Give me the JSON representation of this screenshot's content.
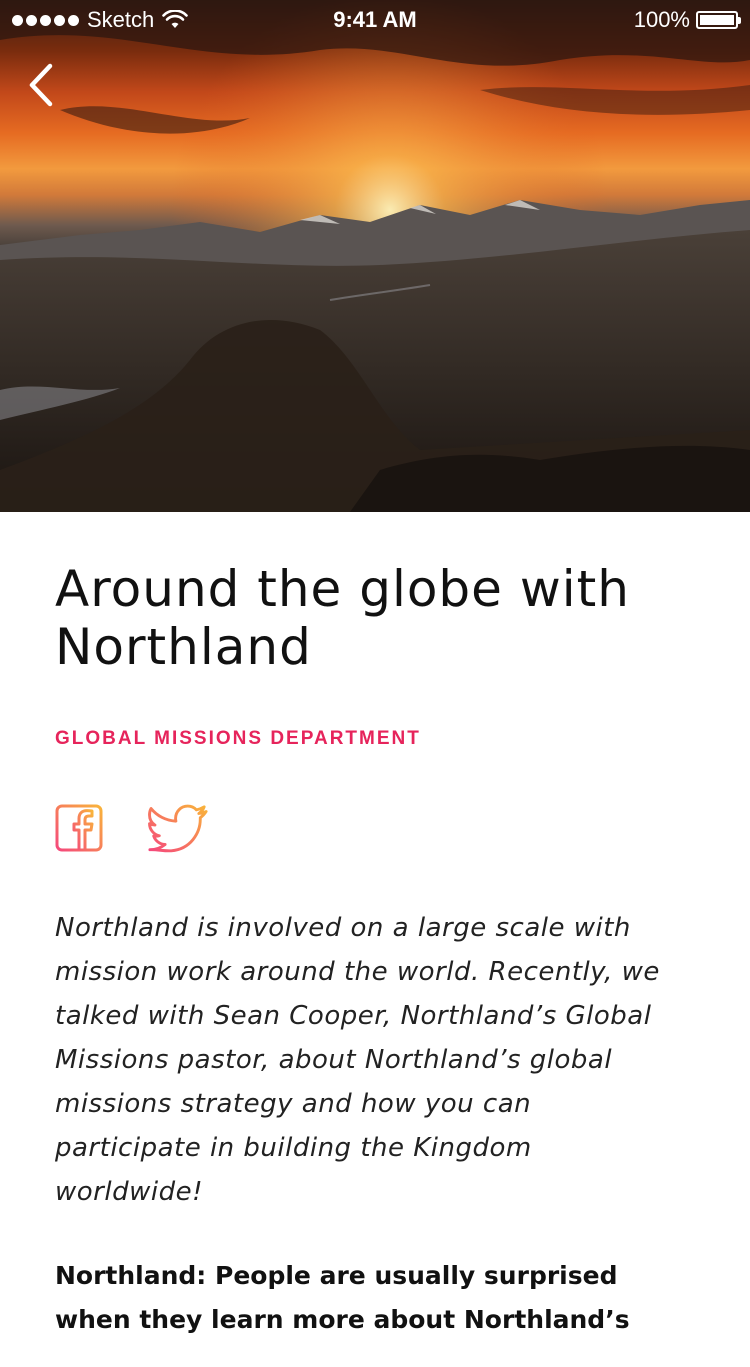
{
  "status_bar": {
    "carrier": "Sketch",
    "time": "9:41 AM",
    "battery": "100%"
  },
  "icons": {
    "back": "chevron-left-icon",
    "facebook": "facebook-icon",
    "twitter": "twitter-icon"
  },
  "article": {
    "title": "Around the globe with Northland",
    "department": "GLOBAL MISSIONS DEPARTMENT",
    "intro": "Northland is involved on a large scale with mission work around the world. Recently, we talked with Sean Cooper, Northland’s Global Missions pastor, about Northland’s global missions strategy and how you can participate in building the Kingdom worldwide!",
    "question": "Northland: People are usually surprised when they learn more about Northland’s"
  },
  "colors": {
    "accent": "#e6245b",
    "icon_gradient_start": "#f5487c",
    "icon_gradient_end": "#f9b43a"
  }
}
